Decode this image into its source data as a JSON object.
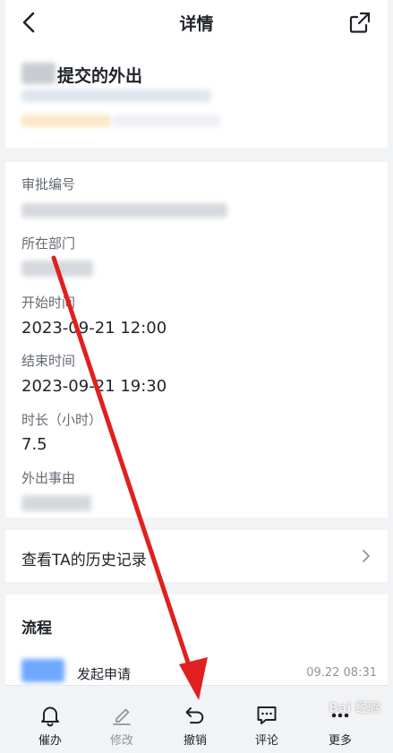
{
  "header": {
    "title": "详情"
  },
  "summary": {
    "title": "提交的外出"
  },
  "details": {
    "fields": [
      {
        "label": "审批编号",
        "value": ""
      },
      {
        "label": "所在部门",
        "value": ""
      },
      {
        "label": "开始时间",
        "value": "2023-09-21 12:00"
      },
      {
        "label": "结束时间",
        "value": "2023-09-21 19:30"
      },
      {
        "label": "时长（小时）",
        "value": "7.5"
      },
      {
        "label": "外出事由",
        "value": ""
      }
    ]
  },
  "history": {
    "label": "查看TA的历史记录"
  },
  "flow": {
    "title": "流程",
    "step_label": "发起申请",
    "step_time": "09.22 08:31"
  },
  "bottom_bar": {
    "items": [
      {
        "label": "催办",
        "icon": "bell-icon"
      },
      {
        "label": "修改",
        "icon": "edit-icon"
      },
      {
        "label": "撤销",
        "icon": "undo-icon"
      },
      {
        "label": "评论",
        "icon": "comment-icon"
      },
      {
        "label": "更多",
        "icon": "more-icon"
      }
    ]
  },
  "watermark": "Bai 经验",
  "colors": {
    "background": "#f2f3f5",
    "card": "#ffffff",
    "primary_text": "#1f2329",
    "secondary_text": "#646a73",
    "annotation_arrow": "#e02020"
  }
}
